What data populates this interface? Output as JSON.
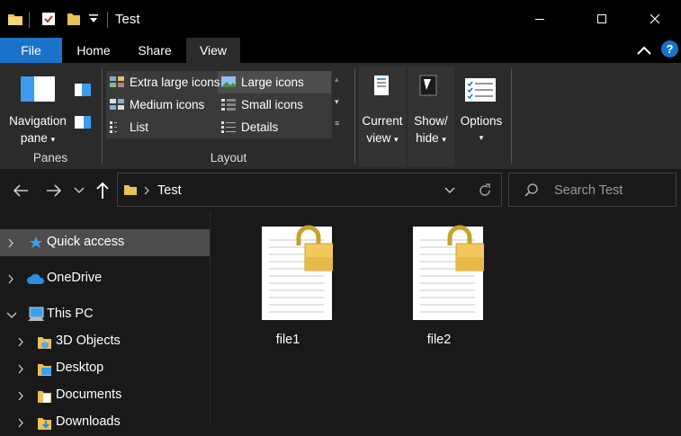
{
  "window": {
    "title": "Test"
  },
  "tabs": [
    {
      "label": "File"
    },
    {
      "label": "Home"
    },
    {
      "label": "Share"
    },
    {
      "label": "View"
    }
  ],
  "ribbon": {
    "panes": {
      "nav_label_1": "Navigation",
      "nav_label_2": "pane",
      "group": "Panes"
    },
    "layout": {
      "group": "Layout",
      "items": [
        {
          "label": "Extra large icons"
        },
        {
          "label": "Large icons"
        },
        {
          "label": "Medium icons"
        },
        {
          "label": "Small icons"
        },
        {
          "label": "List"
        },
        {
          "label": "Details"
        }
      ]
    },
    "current_view": {
      "l1": "Current",
      "l2": "view"
    },
    "show_hide": {
      "l1": "Show/",
      "l2": "hide"
    },
    "options": {
      "label": "Options"
    }
  },
  "address": {
    "path": "Test"
  },
  "search": {
    "placeholder": "Search Test"
  },
  "nav": [
    {
      "label": "Quick access"
    },
    {
      "label": "OneDrive"
    },
    {
      "label": "This PC"
    },
    {
      "label": "3D Objects"
    },
    {
      "label": "Desktop"
    },
    {
      "label": "Documents"
    },
    {
      "label": "Downloads"
    }
  ],
  "files": [
    {
      "name": "file1"
    },
    {
      "name": "file2"
    }
  ],
  "colors": {
    "accent": "#1a73c9",
    "selected": "#4d4d4d",
    "lock": "#e8b848"
  }
}
